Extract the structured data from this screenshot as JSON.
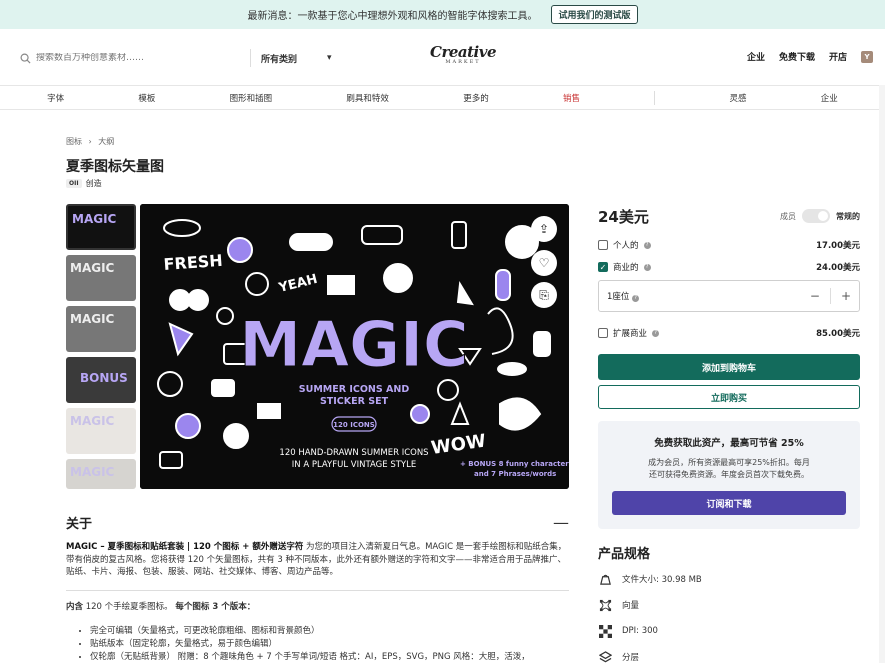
{
  "banner": {
    "text": "最新消息：一款基于您心中理想外观和风格的智能字体搜索工具。",
    "button": "试用我们的测试版"
  },
  "header": {
    "search_placeholder": "搜索数百万种创意素材……",
    "category": "所有类别",
    "logo_main": "Creative",
    "logo_sub": "MARKET",
    "links": [
      "企业",
      "免费下载",
      "开店"
    ],
    "avatar": "Y"
  },
  "nav": [
    "字体",
    "模板",
    "图形和插图",
    "刷具和特效",
    "更多的",
    "销售",
    "灵感",
    "企业"
  ],
  "breadcrumb": {
    "root": "图标",
    "sep": "›",
    "current": "大纲"
  },
  "product": {
    "title": "夏季图标矢量图",
    "creator_tag": "OII",
    "creator": "创造"
  },
  "artwork": {
    "fresh": "FRESH",
    "yeah": "YEAH",
    "magic": "MAGIC",
    "subtitle1": "SUMMER ICONS AND",
    "subtitle2": "STICKER SET",
    "badge": "120 ICONS",
    "tagline1": "120 HAND-DRAWN SUMMER ICONS",
    "tagline2": "IN A PLAYFUL VINTAGE STYLE",
    "wow": "WOW",
    "bonus1": "+ BONUS 8 funny characters",
    "bonus2": "and 7 Phrases/words",
    "thumb_labels": [
      "MAGIC",
      "MAGIC",
      "MAGIC",
      "BONUS",
      "MAGIC",
      "MAGIC"
    ]
  },
  "pricing": {
    "price": "24美元",
    "member_label": "成员",
    "member_toggle": "常规的",
    "licenses": [
      {
        "label": "个人的",
        "amount": "17.00美元",
        "checked": false
      },
      {
        "label": "商业的",
        "amount": "24.00美元",
        "checked": true
      }
    ],
    "seat_label": "1座位",
    "seat_minus": "−",
    "seat_plus": "+",
    "extended": {
      "label": "扩展商业",
      "amount": "85.00美元"
    },
    "add_to_cart": "添加到购物车",
    "buy_now": "立即购买"
  },
  "promo": {
    "title": "免费获取此资产，最高可节省 25%",
    "text1": "成为会员，所有资源最高可享25%折扣。每月",
    "text2": "还可获得免费资源。年度会员首次下载免费。",
    "button": "订阅和下载"
  },
  "about": {
    "title": "关于",
    "collapse": "—",
    "intro_bold": "MAGIC – 夏季图标和贴纸套装 | 120 个图标 + 额外赠送字符",
    "intro_text": " 为您的项目注入清新夏日气息。MAGIC 是一套手绘图标和贴纸合集，带有俏皮的复古风格。您将获得 120 个矢量图标，共有 3 种不同版本，此外还有额外赠送的字符和文字——非常适合用于品牌推广、贴纸、卡片、海报、包装、服装、网站、社交媒体、博客、周边产品等。",
    "contains_pre": "内含",
    "contains_mid": " 120 个手绘夏季图标。",
    "contains_bold": "每个图标 3 个版本：",
    "bullets": [
      "完全可编辑（矢量格式，可更改轮廓粗细、图标和背景颜色）",
      "贴纸版本（固定轮廓，矢量格式，易于颜色编辑）",
      "仅轮廓（无贴纸背景） 附赠：8 个趣味角色 + 7 个手写单词/短语 格式：AI，EPS，SVG，PNG 风格：大胆，活泼，"
    ]
  },
  "specs": {
    "title": "产品规格",
    "items": [
      {
        "icon": "file-size-icon",
        "text": "文件大小: 30.98 MB"
      },
      {
        "icon": "vector-icon",
        "text": "向量"
      },
      {
        "icon": "dpi-icon",
        "text": "DPI: 300"
      },
      {
        "icon": "layers-icon",
        "text": "分层"
      }
    ]
  },
  "colors": {
    "accent": "#136b5c",
    "subscribe": "#4f44a9",
    "sale": "#c93434",
    "art_purple": "#b7a6f4"
  }
}
